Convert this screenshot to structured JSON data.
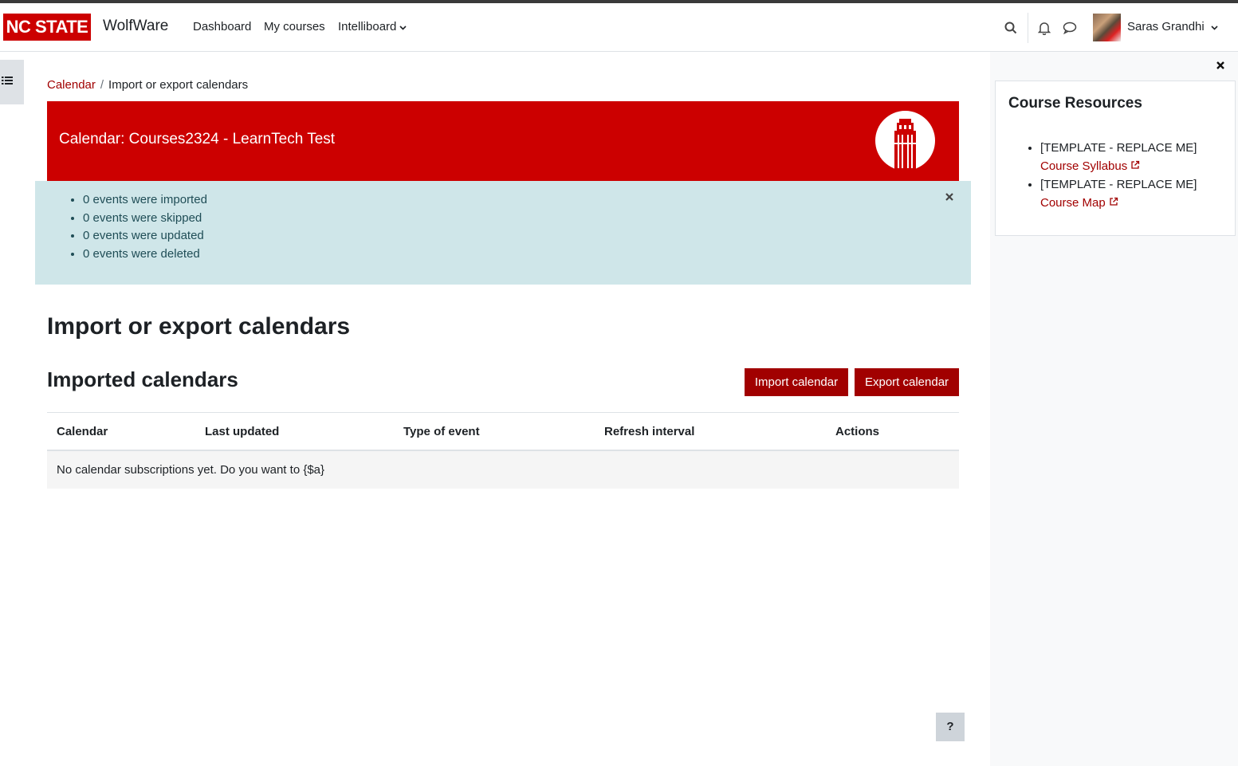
{
  "navbar": {
    "logo_text": "NC STATE",
    "site_name": "WolfWare",
    "links": [
      "Dashboard",
      "My courses",
      "Intelliboard"
    ],
    "user_name": "Saras Grandhi"
  },
  "breadcrumb": {
    "parent": "Calendar",
    "separator": "/",
    "current": "Import or export calendars"
  },
  "hero": {
    "title": "Calendar: Courses2324 - LearnTech Test"
  },
  "alert": {
    "items": [
      "0 events were imported",
      "0 events were skipped",
      "0 events were updated",
      "0 events were deleted"
    ]
  },
  "main": {
    "page_title": "Import or export calendars",
    "section_title": "Imported calendars",
    "import_button": "Import calendar",
    "export_button": "Export calendar"
  },
  "table": {
    "headers": [
      "Calendar",
      "Last updated",
      "Type of event",
      "Refresh interval",
      "Actions"
    ],
    "empty_message": "No calendar subscriptions yet. Do you want to {$a}"
  },
  "right_drawer": {
    "block_title": "Course Resources",
    "resources": [
      {
        "prefix": "[TEMPLATE - REPLACE ME]",
        "link": "Course Syllabus"
      },
      {
        "prefix": "[TEMPLATE - REPLACE ME]",
        "link": "Course Map"
      }
    ]
  },
  "help_button": "?",
  "colors": {
    "brand_red": "#cc0000",
    "button_red": "#a10000",
    "alert_bg": "#cfe6e9"
  }
}
